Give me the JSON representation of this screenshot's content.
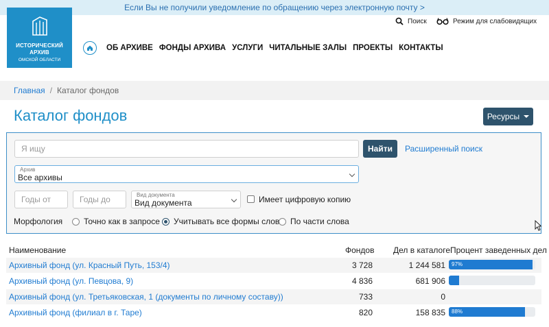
{
  "notice": "Если Вы не получили уведомление по обращению через электронную почту >",
  "logo": {
    "line1": "ИСТОРИЧЕСКИЙ",
    "line2": "АРХИВ",
    "line3": "ОМСКОЙ ОБЛАСТИ"
  },
  "utility": {
    "search": "Поиск",
    "vision": "Режим для слабовидящих"
  },
  "nav": [
    "ОБ АРХИВЕ",
    "ФОНДЫ АРХИВА",
    "УСЛУГИ",
    "ЧИТАЛЬНЫЕ ЗАЛЫ",
    "ПРОЕКТЫ",
    "КОНТАКТЫ"
  ],
  "breadcrumb": {
    "home": "Главная",
    "current": "Каталог фондов"
  },
  "page_title": "Каталог фондов",
  "resources_button": "Ресурсы",
  "filters": {
    "search_placeholder": "Я ищу",
    "find_button": "Найти",
    "advanced_link": "Расширенный поиск",
    "archive_label": "Архив",
    "archive_value": "Все архивы",
    "year_from_placeholder": "Годы от",
    "year_to_placeholder": "Годы до",
    "doctype_label": "Вид документа",
    "doctype_value": "Вид документа",
    "digital_copy": "Имеет цифровую копию",
    "morphology_label": "Морфология",
    "morphology_options": [
      "Точно как в запросе",
      "Учитывать все формы слов",
      "По части слова"
    ],
    "morphology_selected": 1
  },
  "table": {
    "headers": [
      "Наименование",
      "Фондов",
      "Дел в каталоге",
      "Процент заведенных дел"
    ],
    "rows": [
      {
        "name": "Архивный фонд (ул. Красный Путь, 153/4)",
        "funds": "3 728",
        "cases": "1 244 581",
        "percent": 97,
        "percent_label": "97%"
      },
      {
        "name": "Архивный фонд (ул. Певцова, 9)",
        "funds": "4 836",
        "cases": "681 906",
        "percent": 12,
        "percent_label": ""
      },
      {
        "name": "Архивный фонд (ул. Третьяковская, 1 (документы по личному составу))",
        "funds": "733",
        "cases": "0",
        "percent": null,
        "percent_label": ""
      },
      {
        "name": "Архивный фонд (филиал в г. Таре)",
        "funds": "820",
        "cases": "158 835",
        "percent": 88,
        "percent_label": "88%"
      }
    ]
  },
  "colors": {
    "brand": "#1f8fc8",
    "button": "#2e536c",
    "link": "#1f7bd1"
  }
}
